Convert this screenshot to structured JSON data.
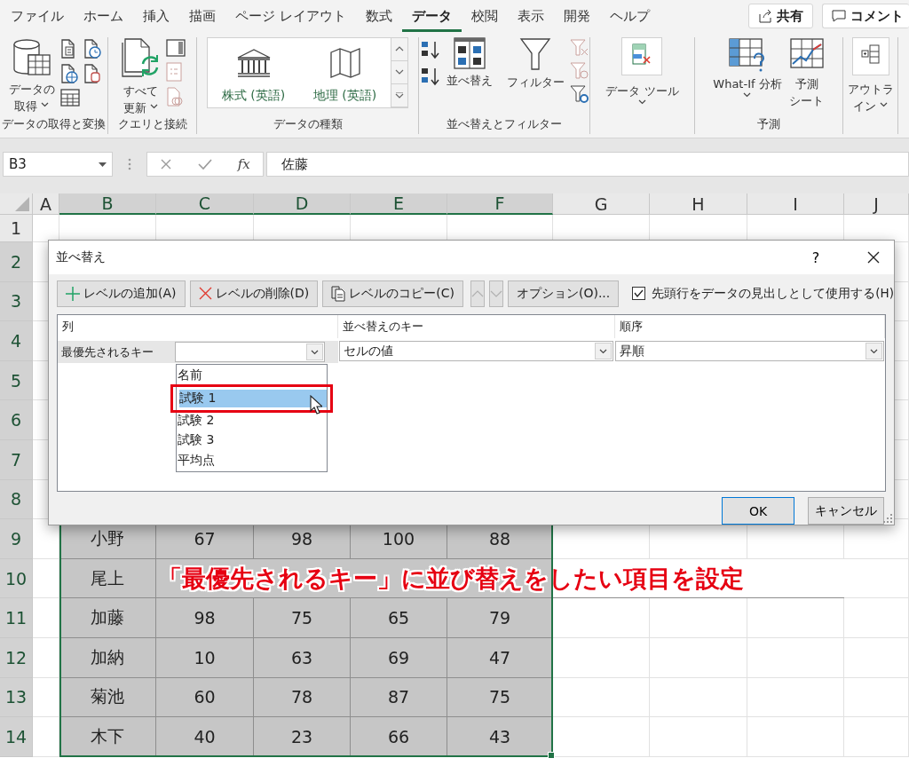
{
  "ribbon": {
    "tabs": [
      {
        "label": "ファイル",
        "selected": false
      },
      {
        "label": "ホーム",
        "selected": false
      },
      {
        "label": "挿入",
        "selected": false
      },
      {
        "label": "描画",
        "selected": false
      },
      {
        "label": "ページ レイアウト",
        "selected": false
      },
      {
        "label": "数式",
        "selected": false
      },
      {
        "label": "データ",
        "selected": true
      },
      {
        "label": "校閲",
        "selected": false
      },
      {
        "label": "表示",
        "selected": false
      },
      {
        "label": "開発",
        "selected": false
      },
      {
        "label": "ヘルプ",
        "selected": false
      }
    ],
    "share_button": "共有",
    "comment_button": "コメント",
    "groups": [
      {
        "kind": "get-data",
        "label": "データの取得と変換",
        "buttons": [
          {
            "label": [
              "データの",
              "取得"
            ],
            "dropdown": true
          }
        ]
      },
      {
        "kind": "queries",
        "label": "クエリと接続",
        "buttons": [
          {
            "label": [
              "すべて",
              "更新"
            ],
            "dropdown": true
          }
        ]
      },
      {
        "kind": "gallery",
        "label": "データの種類",
        "buttons": [
          {
            "label": [
              "株式 (英語)"
            ],
            "dropdown": false
          },
          {
            "label": [
              "地理 (英語)"
            ],
            "dropdown": false
          }
        ]
      },
      {
        "kind": "sort-filter",
        "label": "並べ替えとフィルター",
        "buttons": [
          {
            "label": [
              "並べ替え"
            ],
            "dropdown": false
          },
          {
            "label": [
              "フィルター"
            ],
            "dropdown": false
          }
        ]
      },
      {
        "kind": "tools",
        "buttons": [
          {
            "label": [
              "データ ツール"
            ],
            "dropdown": true
          }
        ]
      },
      {
        "kind": "forecast",
        "label": "予測",
        "buttons": [
          {
            "label": [
              "What-If 分析"
            ],
            "dropdown": true
          },
          {
            "label": [
              "予測",
              "シート"
            ],
            "dropdown": false
          }
        ]
      },
      {
        "kind": "outline",
        "buttons": [
          {
            "label": [
              "アウトラ",
              "イン"
            ],
            "dropdown": true
          }
        ]
      }
    ]
  },
  "formula_bar": {
    "name_box": "B3",
    "fx": "fx",
    "value": "佐藤"
  },
  "sheet": {
    "columns": [
      {
        "label": "A",
        "selected": false
      },
      {
        "label": "B",
        "selected": true
      },
      {
        "label": "C",
        "selected": true
      },
      {
        "label": "D",
        "selected": true
      },
      {
        "label": "E",
        "selected": true
      },
      {
        "label": "F",
        "selected": true
      },
      {
        "label": "G",
        "selected": false
      },
      {
        "label": "H",
        "selected": false
      },
      {
        "label": "I",
        "selected": false
      },
      {
        "label": "J",
        "selected": false
      }
    ],
    "rows": [
      {
        "number": "1",
        "selected": false,
        "cells": []
      },
      {
        "number": "2",
        "selected": true,
        "cells": []
      },
      {
        "number": "3",
        "selected": true,
        "cells": []
      },
      {
        "number": "4",
        "selected": true,
        "cells": []
      },
      {
        "number": "5",
        "selected": true,
        "cells": []
      },
      {
        "number": "6",
        "selected": true,
        "cells": []
      },
      {
        "number": "7",
        "selected": true,
        "cells": []
      },
      {
        "number": "8",
        "selected": true,
        "cells": []
      },
      {
        "number": "9",
        "selected": true,
        "cells": [
          "",
          "小野",
          "67",
          "98",
          "100",
          "88"
        ]
      },
      {
        "number": "10",
        "selected": true,
        "cells": [
          "",
          "尾上"
        ]
      },
      {
        "number": "11",
        "selected": true,
        "cells": [
          "",
          "加藤",
          "98",
          "75",
          "65",
          "79"
        ]
      },
      {
        "number": "12",
        "selected": true,
        "cells": [
          "",
          "加納",
          "10",
          "63",
          "69",
          "47"
        ]
      },
      {
        "number": "13",
        "selected": true,
        "cells": [
          "",
          "菊池",
          "60",
          "78",
          "87",
          "75"
        ]
      },
      {
        "number": "14",
        "selected": true,
        "cells": [
          "",
          "木下",
          "40",
          "23",
          "66",
          "43"
        ]
      }
    ]
  },
  "dialog": {
    "title": "並べ替え",
    "help": "?",
    "toolbar": [
      {
        "kind": "add",
        "label": "レベルの追加(A)"
      },
      {
        "kind": "delete",
        "label": "レベルの削除(D)"
      },
      {
        "kind": "copy",
        "label": "レベルのコピー(C)"
      },
      {
        "kind": "up",
        "disabled": true
      },
      {
        "kind": "down",
        "disabled": true
      },
      {
        "kind": "text",
        "label": "オプション(O)..."
      }
    ],
    "header_checkbox": {
      "label": "先頭行をデータの見出しとして使用する(H)",
      "checked": true
    },
    "columns": [
      "列",
      "並べ替えのキー",
      "順序"
    ],
    "levels": [
      {
        "label": "最優先されるキー",
        "sort_on": "セルの値",
        "order": "昇順"
      }
    ],
    "dropdown": {
      "items": [
        {
          "label": "名前",
          "selected": false
        },
        {
          "label": "試験 1",
          "selected": true
        },
        {
          "label": "試験 2",
          "selected": false
        },
        {
          "label": "試験 3",
          "selected": false
        },
        {
          "label": "平均点",
          "selected": false
        }
      ]
    },
    "buttons": [
      {
        "kind": "primary",
        "label": "OK"
      },
      {
        "kind": "secondary",
        "label": "キャンセル"
      }
    ]
  },
  "annotation": {
    "text": "「最優先されるキー」に並び替えをしたい項目を設定"
  }
}
